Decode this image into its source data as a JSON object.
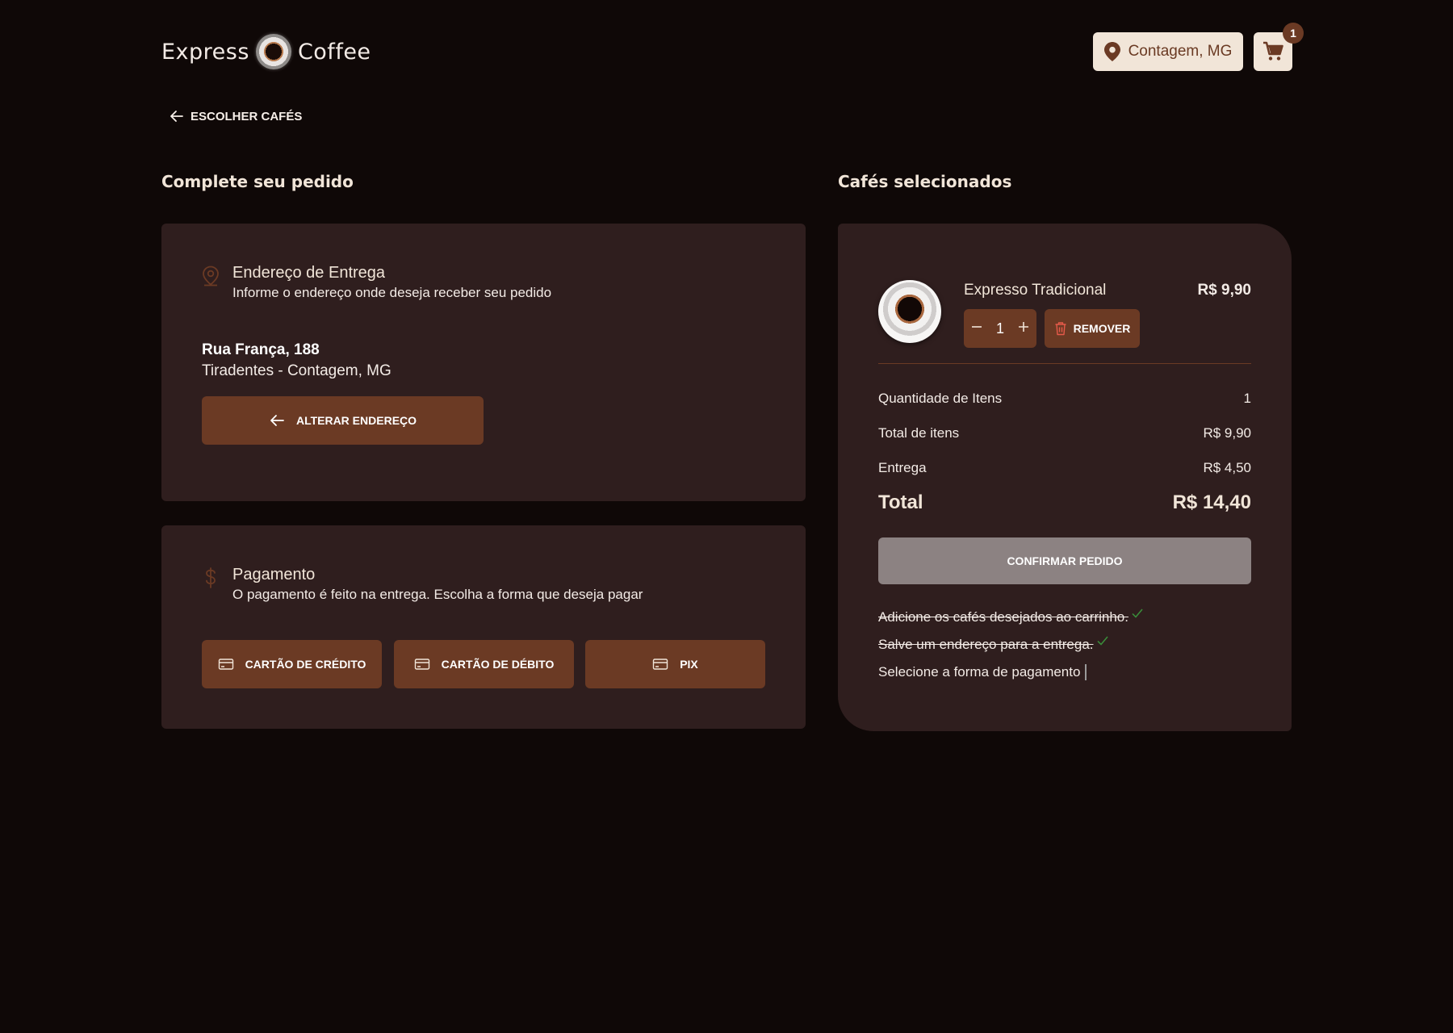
{
  "header": {
    "logo_left": "Express",
    "logo_right": "Coffee",
    "location": "Contagem, MG",
    "cart_count": "1"
  },
  "nav": {
    "back_label": "ESCOLHER CAFÉS"
  },
  "order_form": {
    "title": "Complete seu pedido",
    "address_section": {
      "heading": "Endereço de Entrega",
      "subheading": "Informe o endereço onde deseja receber seu pedido",
      "street": "Rua França, 188",
      "district": "Tiradentes - Contagem, MG",
      "change_button": "ALTERAR ENDEREÇO"
    },
    "payment_section": {
      "heading": "Pagamento",
      "subheading": "O pagamento é feito na entrega. Escolha a forma que deseja pagar",
      "options": [
        "CARTÃO DE CRÉDITO",
        "CARTÃO DE DÉBITO",
        "PIX"
      ]
    }
  },
  "cart": {
    "title": "Cafés selecionados",
    "items": [
      {
        "name": "Expresso Tradicional",
        "price": "R$ 9,90",
        "quantity": "1",
        "remove_label": "REMOVER"
      }
    ],
    "summary": {
      "items_count_label": "Quantidade de Itens",
      "items_count_value": "1",
      "items_total_label": "Total de itens",
      "items_total_value": "R$ 9,90",
      "delivery_label": "Entrega",
      "delivery_value": "R$ 4,50",
      "total_label": "Total",
      "total_value": "R$ 14,40"
    },
    "confirm_button": "CONFIRMAR PEDIDO",
    "checklist": [
      {
        "text": "Adicione os cafés desejados ao carrinho.",
        "done": true
      },
      {
        "text": "Salve um endereço para a entrega.",
        "done": true
      },
      {
        "text": "Selecione a forma de pagamento",
        "done": false
      }
    ]
  },
  "colors": {
    "background": "#0f0807",
    "card": "#2f1e1e",
    "accent_brown": "#6b3a24",
    "cream": "#f1e5d8",
    "check_green": "#3a8f3a",
    "disabled_gray": "#8c8282"
  },
  "icons": {
    "location": "map-pin-icon",
    "cart": "shopping-cart-icon",
    "back": "arrow-left-icon",
    "address": "map-pin-outline-icon",
    "payment": "dollar-icon",
    "card": "credit-card-icon",
    "remove": "trash-icon",
    "minus": "minus-icon",
    "plus": "plus-icon",
    "check": "check-icon"
  }
}
